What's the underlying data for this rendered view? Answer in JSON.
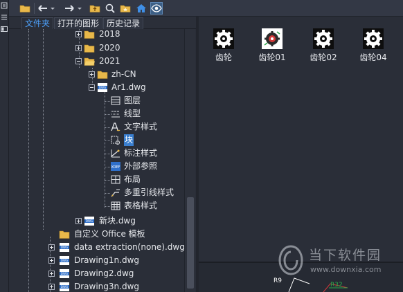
{
  "toolbar": {
    "icons": [
      "folder-icon",
      "back-arrow-icon",
      "dropdown-icon",
      "forward-arrow-icon",
      "dropdown-icon",
      "up-folder-icon",
      "search-icon",
      "favorites-icon",
      "home-icon",
      "eye-icon"
    ]
  },
  "tabs": [
    "文件夹",
    "打开的图形",
    "历史记录"
  ],
  "tree": {
    "rows": [
      {
        "label": "2018",
        "icon": "folder"
      },
      {
        "label": "2020",
        "icon": "folder"
      },
      {
        "label": "2021",
        "icon": "folder"
      },
      {
        "label": "zh-CN",
        "icon": "folder"
      },
      {
        "label": "Ar1.dwg",
        "icon": "dwg"
      },
      {
        "label": "图层",
        "icon": "layer"
      },
      {
        "label": "线型",
        "icon": "linetype"
      },
      {
        "label": "文字样式",
        "icon": "textstyle"
      },
      {
        "label": "块",
        "icon": "block"
      },
      {
        "label": "标注样式",
        "icon": "dimstyle"
      },
      {
        "label": "外部参照",
        "icon": "xref"
      },
      {
        "label": "布局",
        "icon": "layout"
      },
      {
        "label": "多重引线样式",
        "icon": "mleader"
      },
      {
        "label": "表格样式",
        "icon": "tablestyle"
      },
      {
        "label": "新块.dwg",
        "icon": "dwg"
      },
      {
        "label": "自定义 Office 模板",
        "icon": "folder"
      },
      {
        "label": "data extraction(none).dwg",
        "icon": "dwg"
      },
      {
        "label": "Drawing1n.dwg",
        "icon": "dwg"
      },
      {
        "label": "Drawing2.dwg",
        "icon": "dwg"
      },
      {
        "label": "Drawing3n.dwg",
        "icon": "dwg"
      }
    ]
  },
  "content": {
    "items": [
      "齿轮",
      "齿轮01",
      "齿轮02",
      "齿轮04"
    ]
  },
  "preview": {
    "labels": [
      "R9",
      "R32"
    ]
  },
  "watermark": {
    "title": "当下软件园",
    "url": "www.downxia.com"
  },
  "colors": {
    "accent": "#4ea3ff",
    "background": "#2a2e38",
    "folder": "#e8b84a"
  }
}
